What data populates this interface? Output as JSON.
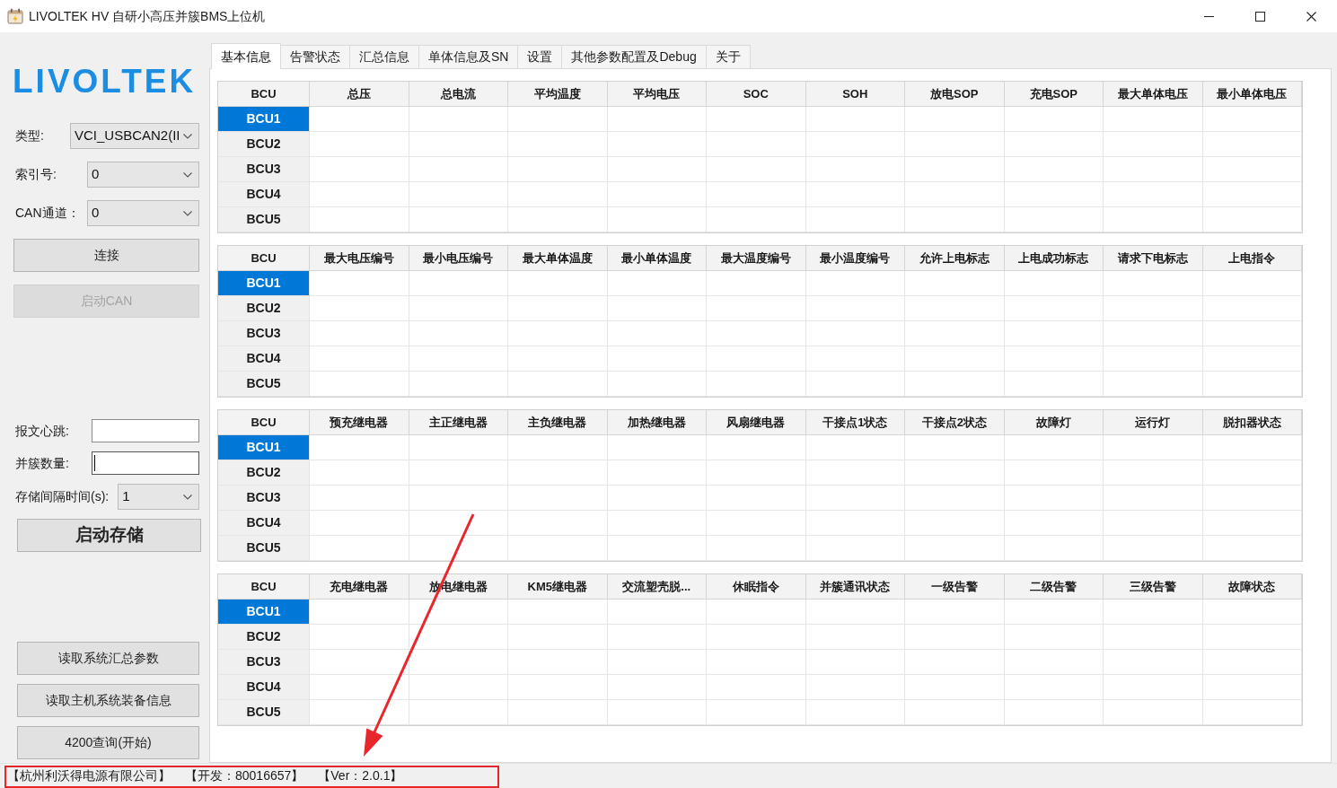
{
  "window": {
    "title": "LIVOLTEK HV 自研小高压并簇BMS上位机"
  },
  "sidebar": {
    "logo": "LIVOLTEK",
    "connection": [
      {
        "kind": "combo",
        "label": "类型:",
        "value": "VCI_USBCAN2(II"
      },
      {
        "kind": "combo",
        "label": "索引号:",
        "value": "0"
      },
      {
        "kind": "combo",
        "label": "CAN通道：",
        "value": "0"
      },
      {
        "kind": "button",
        "label": "连接",
        "disabled": false
      },
      {
        "kind": "button",
        "label": "启动CAN",
        "disabled": true
      }
    ],
    "storage": [
      {
        "kind": "input",
        "label": "报文心跳:",
        "focused": false
      },
      {
        "kind": "input",
        "label": "并簇数量:",
        "focused": true
      },
      {
        "kind": "combo",
        "label": "存储间隔时间(s):",
        "value": "1"
      },
      {
        "kind": "bigbutton",
        "label": "启动存储",
        "disabled": false
      }
    ],
    "queries": [
      {
        "kind": "button",
        "label": "读取系统汇总参数",
        "disabled": false
      },
      {
        "kind": "button",
        "label": "读取主机系统装备信息",
        "disabled": false
      },
      {
        "kind": "button",
        "label": "4200查询(开始)",
        "disabled": false
      }
    ]
  },
  "tabs": [
    {
      "label": "基本信息",
      "selected": true
    },
    {
      "label": "告警状态",
      "selected": false
    },
    {
      "label": "汇总信息",
      "selected": false
    },
    {
      "label": "单体信息及SN",
      "selected": false
    },
    {
      "label": "设置",
      "selected": false
    },
    {
      "label": "其他参数配置及Debug",
      "selected": false
    },
    {
      "label": "关于",
      "selected": false
    }
  ],
  "tables": [
    {
      "columns": [
        "BCU",
        "总压",
        "总电流",
        "平均温度",
        "平均电压",
        "SOC",
        "SOH",
        "放电SOP",
        "充电SOP",
        "最大单体电压",
        "最小单体电压"
      ],
      "rows": [
        {
          "label": "BCU1",
          "selected": true
        },
        {
          "label": "BCU2",
          "selected": false
        },
        {
          "label": "BCU3",
          "selected": false
        },
        {
          "label": "BCU4",
          "selected": false
        },
        {
          "label": "BCU5",
          "selected": false
        }
      ]
    },
    {
      "columns": [
        "BCU",
        "最大电压编号",
        "最小电压编号",
        "最大单体温度",
        "最小单体温度",
        "最大温度编号",
        "最小温度编号",
        "允许上电标志",
        "上电成功标志",
        "请求下电标志",
        "上电指令"
      ],
      "rows": [
        {
          "label": "BCU1",
          "selected": true
        },
        {
          "label": "BCU2",
          "selected": false
        },
        {
          "label": "BCU3",
          "selected": false
        },
        {
          "label": "BCU4",
          "selected": false
        },
        {
          "label": "BCU5",
          "selected": false
        }
      ]
    },
    {
      "columns": [
        "BCU",
        "预充继电器",
        "主正继电器",
        "主负继电器",
        "加热继电器",
        "风扇继电器",
        "干接点1状态",
        "干接点2状态",
        "故障灯",
        "运行灯",
        "脱扣器状态"
      ],
      "rows": [
        {
          "label": "BCU1",
          "selected": true
        },
        {
          "label": "BCU2",
          "selected": false
        },
        {
          "label": "BCU3",
          "selected": false
        },
        {
          "label": "BCU4",
          "selected": false
        },
        {
          "label": "BCU5",
          "selected": false
        }
      ]
    },
    {
      "columns": [
        "BCU",
        "充电继电器",
        "放电继电器",
        "KM5继电器",
        "交流塑壳脱...",
        "休眠指令",
        "并簇通讯状态",
        "一级告警",
        "二级告警",
        "三级告警",
        "故障状态"
      ],
      "rows": [
        {
          "label": "BCU1",
          "selected": true
        },
        {
          "label": "BCU2",
          "selected": false
        },
        {
          "label": "BCU3",
          "selected": false
        },
        {
          "label": "BCU4",
          "selected": false
        },
        {
          "label": "BCU5",
          "selected": false
        }
      ]
    }
  ],
  "status_bar": {
    "items": [
      "【杭州利沃得电源有限公司】",
      "【开发：80016657】",
      "【Ver：2.0.1】"
    ]
  },
  "annotations": {
    "arrow": true,
    "highlight_frame": true
  }
}
